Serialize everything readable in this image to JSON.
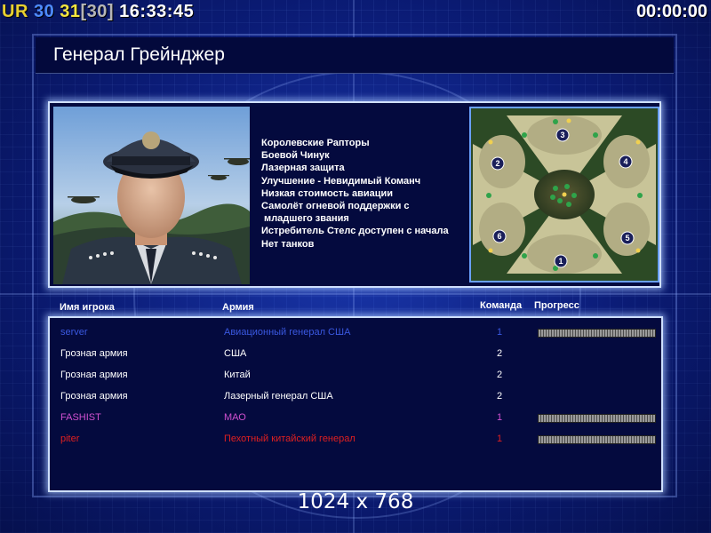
{
  "hud": {
    "prefix": "UR",
    "num_a": "30",
    "num_b": "31",
    "num_c": "[30]",
    "clock": "16:33:45",
    "timer": "00:00:00"
  },
  "general": {
    "title": "Генерал Грейнджер",
    "features": [
      "Королевские Рапторы",
      "Боевой Чинук",
      "Лазерная защита",
      "Улучшение - Невидимый Команч",
      "Низкая стоимость авиации",
      "Самолёт огневой поддержки с",
      " младшего звания",
      "Истребитель Стелс доступен с начала",
      "Нет танков"
    ]
  },
  "minimap": {
    "start_positions": [
      "1",
      "2",
      "3",
      "4",
      "5",
      "6"
    ]
  },
  "table": {
    "headers": {
      "player": "Имя игрока",
      "army": "Армия",
      "team": "Команда",
      "progress": "Прогресс"
    },
    "rows": [
      {
        "name": "server",
        "army": "Авиационный генерал США",
        "team": "1",
        "color": "#3a58e0",
        "progress": 1.0
      },
      {
        "name": "Грозная армия",
        "army": "США",
        "team": "2",
        "color": "#ffffff",
        "progress": null
      },
      {
        "name": "Грозная армия",
        "army": "Китай",
        "team": "2",
        "color": "#ffffff",
        "progress": null
      },
      {
        "name": "Грозная армия",
        "army": "Лазерный генерал США",
        "team": "2",
        "color": "#ffffff",
        "progress": null
      },
      {
        "name": "FASHIST",
        "army": "МАО",
        "team": "1",
        "color": "#d050d0",
        "progress": 1.0
      },
      {
        "name": "piter",
        "army": "Пехотный китайский генерал",
        "team": "1",
        "color": "#e02020",
        "progress": 1.0
      }
    ]
  },
  "resolution": "1024 x 768"
}
